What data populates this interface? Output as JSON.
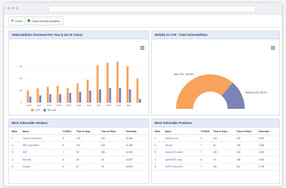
{
  "tabs": [
    {
      "label": "Home",
      "color": "#f7a35c"
    },
    {
      "label": "Cybersecurity Analytics",
      "color": "#43a047"
    }
  ],
  "bar_panel": {
    "title": "Vulnerabilities Disclosed Per Year (Last 10 Years)"
  },
  "donut_panel": {
    "title": "Web(D) vs CVE - Total Vulnerabilities"
  },
  "vendors_panel": {
    "title": "Most Vulnerable Vendors"
  },
  "products_panel": {
    "title": "Most Vulnerable Products"
  },
  "chart_data": [
    {
      "type": "bar",
      "title": "Vulnerabilities Disclosed Per Year (Last 10 Years)",
      "categories": [
        "2010",
        "2011",
        "2012",
        "2013",
        "2014",
        "2015",
        "2016",
        "2017",
        "2018",
        "2019",
        "2020"
      ],
      "ylim": [
        0,
        4
      ],
      "yticks": [
        "0",
        "1k",
        "2k",
        "3k"
      ],
      "series": [
        {
          "name": "CVE",
          "color": "#f7a35c",
          "values": [
            1.0,
            1.2,
            1.3,
            1.4,
            1.2,
            1.6,
            1.9,
            3.1,
            3.3,
            3.4,
            3.0,
            2.0
          ]
        },
        {
          "name": "Not Link",
          "color": "#7b85b5",
          "values": [
            0.5,
            0.6,
            0.7,
            0.7,
            0.8,
            0.9,
            1.0,
            1.1,
            1.2,
            1.2,
            1.1,
            0.3
          ]
        }
      ]
    },
    {
      "type": "pie",
      "title": "Web(D) vs CVE - Total Vulnerabilities",
      "slices": [
        {
          "label": "Non-CVE: 145,401",
          "value": 145401,
          "color": "#f7a35c"
        },
        {
          "label": "Without CVE: 55,017",
          "value": 55017,
          "color": "#7b85b5"
        }
      ]
    }
  ],
  "vendors": {
    "headers": [
      "Rank",
      "Name",
      "CVSSv2",
      "Time to Expl...",
      "Time to Patch",
      "Vulnerabi..."
    ],
    "rows": [
      [
        "1",
        "Oracle Corporation",
        "6",
        "129",
        "240",
        "11,308"
      ],
      [
        "2",
        "IBM Corporation",
        "6",
        "114",
        "216",
        "11,186"
      ],
      [
        "3",
        "SAP",
        "7",
        "93",
        "155",
        "11,283"
      ],
      [
        "4",
        "Red Hat",
        "6",
        "25",
        "75",
        "10,677"
      ],
      [
        "5",
        "Google",
        "6",
        "87",
        "75",
        "10,575"
      ]
    ]
  },
  "products": {
    "headers": [
      "Rank",
      "Name",
      "CVSSv2",
      "Time to Expl...",
      "Time to Patch",
      "Vulnerabi..."
    ],
    "rows": [
      [
        "1",
        "Debian Linux",
        "6",
        "102",
        "100",
        "2,057"
      ],
      [
        "2",
        "Ubuntu",
        "7",
        "94",
        "128",
        "2,018"
      ],
      [
        "3",
        "Android Firmware",
        "7",
        "102",
        "100",
        "1,822"
      ],
      [
        "4",
        "openSUSE Leap",
        "6",
        "70",
        "136",
        "1,633"
      ],
      [
        "5",
        "SuSE Linux Ente...",
        "7",
        "110",
        "211",
        "1,708"
      ]
    ]
  }
}
